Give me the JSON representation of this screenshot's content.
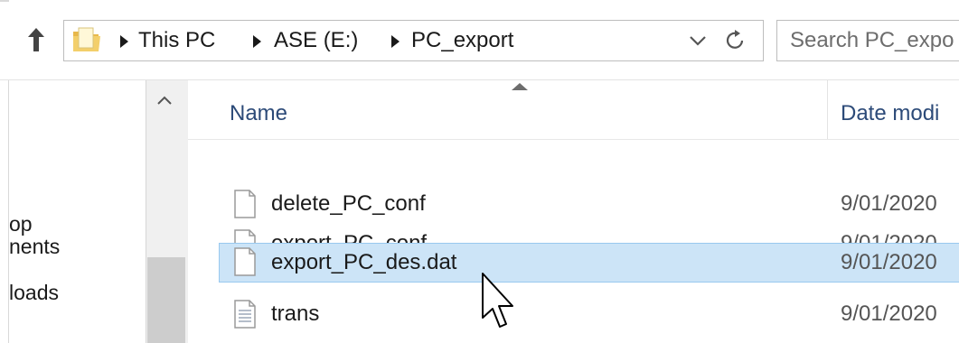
{
  "breadcrumb": [
    "This PC",
    "ASE (E:)",
    "PC_export"
  ],
  "search": {
    "placeholder": "Search PC_expo"
  },
  "nav": {
    "items": [
      "op",
      "nents",
      "loads"
    ]
  },
  "list": {
    "columns": {
      "name": "Name",
      "date": "Date modi"
    },
    "files": [
      {
        "name": "delete_PC_conf",
        "date": "9/01/2020",
        "icon": "document-icon",
        "selected": false
      },
      {
        "name": "export_PC_conf",
        "date": "9/01/2020",
        "icon": "document-icon",
        "selected": false
      },
      {
        "name": "export_PC_des.dat",
        "date": "9/01/2020",
        "icon": "document-icon",
        "selected": true
      },
      {
        "name": "trans",
        "date": "9/01/2020",
        "icon": "text-document-icon",
        "selected": false
      }
    ]
  },
  "colors": {
    "selection": "#cce4f7",
    "selection_border": "#99c9ef",
    "header_text": "#2c4a78"
  }
}
